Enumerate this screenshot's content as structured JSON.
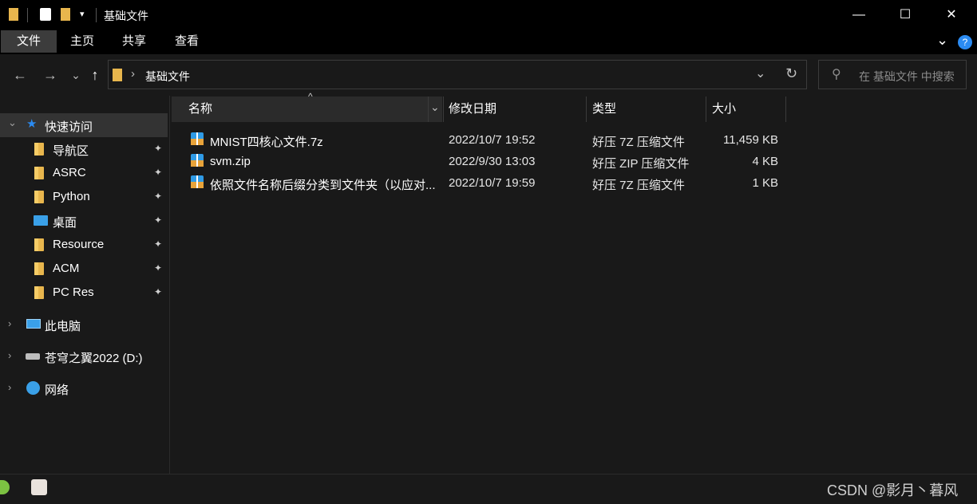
{
  "window": {
    "title": "基础文件",
    "minimize_glyph": "—",
    "maximize_glyph": "☐",
    "close_glyph": "✕"
  },
  "ribbon": {
    "tabs": [
      "文件",
      "主页",
      "共享",
      "查看"
    ],
    "expand_glyph": "⌄",
    "help_glyph": "?"
  },
  "nav": {
    "back_glyph": "←",
    "forward_glyph": "→",
    "recent_glyph": "⌄",
    "up_glyph": "↑",
    "address": "基础文件",
    "address_sep": "›",
    "refresh_glyph": "↻",
    "dropdown_glyph": "⌄",
    "search_placeholder": "在 基础文件 中搜索",
    "search_glyph": "⚲"
  },
  "sidebar": {
    "quick_access": "快速访问",
    "pinned": [
      {
        "label": "导航区",
        "icon": "folder-icon"
      },
      {
        "label": "ASRC",
        "icon": "folder-icon"
      },
      {
        "label": "Python",
        "icon": "folder-icon"
      },
      {
        "label": "桌面",
        "icon": "desktop-icon"
      },
      {
        "label": "Resource",
        "icon": "folder-icon"
      },
      {
        "label": "ACM",
        "icon": "folder-icon"
      },
      {
        "label": "PC Res",
        "icon": "folder-icon"
      }
    ],
    "pin_glyph": "📌",
    "this_pc": "此电脑",
    "drive": "苍穹之翼2022 (D:)",
    "network": "网络",
    "expand_glyph": "›",
    "collapse_glyph": "⌄"
  },
  "columns": {
    "name": "名称",
    "modified": "修改日期",
    "type": "类型",
    "size": "大小",
    "sort_glyph": "^",
    "filter_glyph": "⌄"
  },
  "files": [
    {
      "name": "MNIST四核心文件.7z",
      "modified": "2022/10/7 19:52",
      "type": "好压 7Z 压缩文件",
      "size": "11,459 KB"
    },
    {
      "name": "svm.zip",
      "modified": "2022/9/30 13:03",
      "type": "好压 ZIP 压缩文件",
      "size": "4 KB"
    },
    {
      "name": "依照文件名称后缀分类到文件夹（以应对...",
      "modified": "2022/10/7 19:59",
      "type": "好压 7Z 压缩文件",
      "size": "1 KB"
    }
  ],
  "watermark": "CSDN @影月丶暮风",
  "colors": {
    "background": "#191919",
    "titlebar": "#000000",
    "selected_tab": "#3c3c3c",
    "header_sorted": "#2b2b2b",
    "quick_access_star": "#2b8bf2",
    "folder": "#e8b64d"
  }
}
